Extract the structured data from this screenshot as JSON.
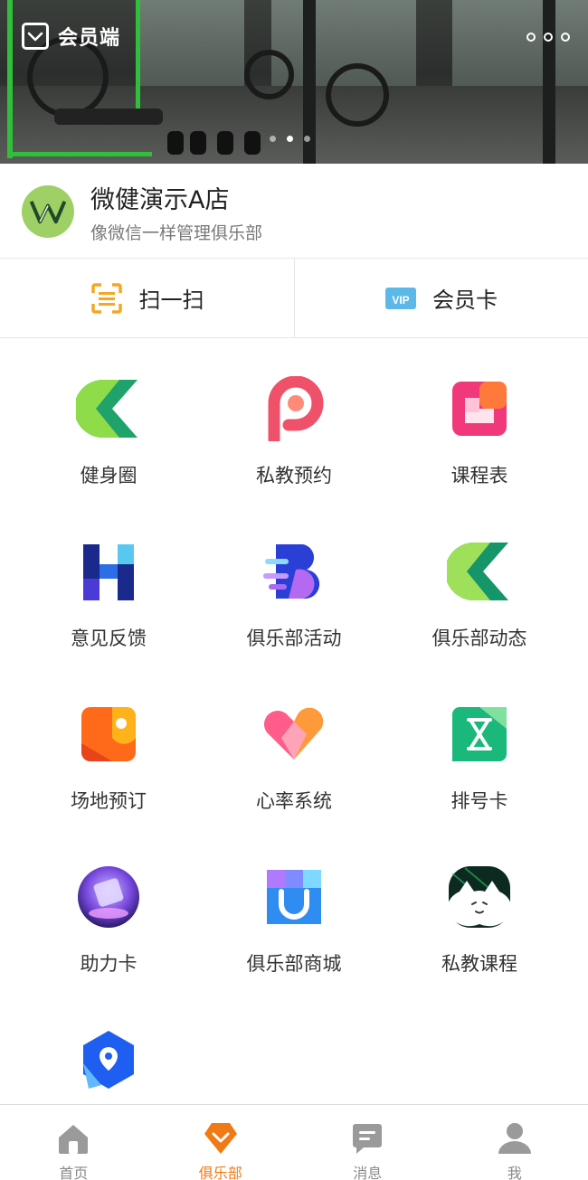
{
  "header": {
    "title": "会员端",
    "carousel_total": 3,
    "carousel_active_index": 1
  },
  "store": {
    "name": "微健演示A店",
    "slogan": "像微信一样管理俱乐部",
    "logo_letter": "W",
    "logo_color": "#9fd066"
  },
  "quick_actions": [
    {
      "label": "扫一扫",
      "icon": "scan-icon",
      "color": "#f5a623"
    },
    {
      "label": "会员卡",
      "icon": "vip-card-icon",
      "color": "#5bb8e8"
    }
  ],
  "features": [
    {
      "label": "健身圈",
      "icon": "fitness-circle-icon"
    },
    {
      "label": "私教预约",
      "icon": "private-coach-booking-icon"
    },
    {
      "label": "课程表",
      "icon": "schedule-icon"
    },
    {
      "label": "意见反馈",
      "icon": "feedback-icon"
    },
    {
      "label": "俱乐部活动",
      "icon": "club-activity-icon"
    },
    {
      "label": "俱乐部动态",
      "icon": "club-news-icon"
    },
    {
      "label": "场地预订",
      "icon": "venue-booking-icon"
    },
    {
      "label": "心率系统",
      "icon": "heart-rate-icon"
    },
    {
      "label": "排号卡",
      "icon": "queue-card-icon"
    },
    {
      "label": "助力卡",
      "icon": "boost-card-icon"
    },
    {
      "label": "俱乐部商城",
      "icon": "club-store-icon"
    },
    {
      "label": "私教课程",
      "icon": "private-course-icon"
    },
    {
      "label": "",
      "icon": "location-icon"
    }
  ],
  "tabbar": {
    "active": 1,
    "accent": "#f07a14",
    "items": [
      {
        "label": "首页",
        "icon": "home-icon"
      },
      {
        "label": "俱乐部",
        "icon": "club-icon"
      },
      {
        "label": "消息",
        "icon": "message-icon"
      },
      {
        "label": "我",
        "icon": "profile-icon"
      }
    ]
  }
}
